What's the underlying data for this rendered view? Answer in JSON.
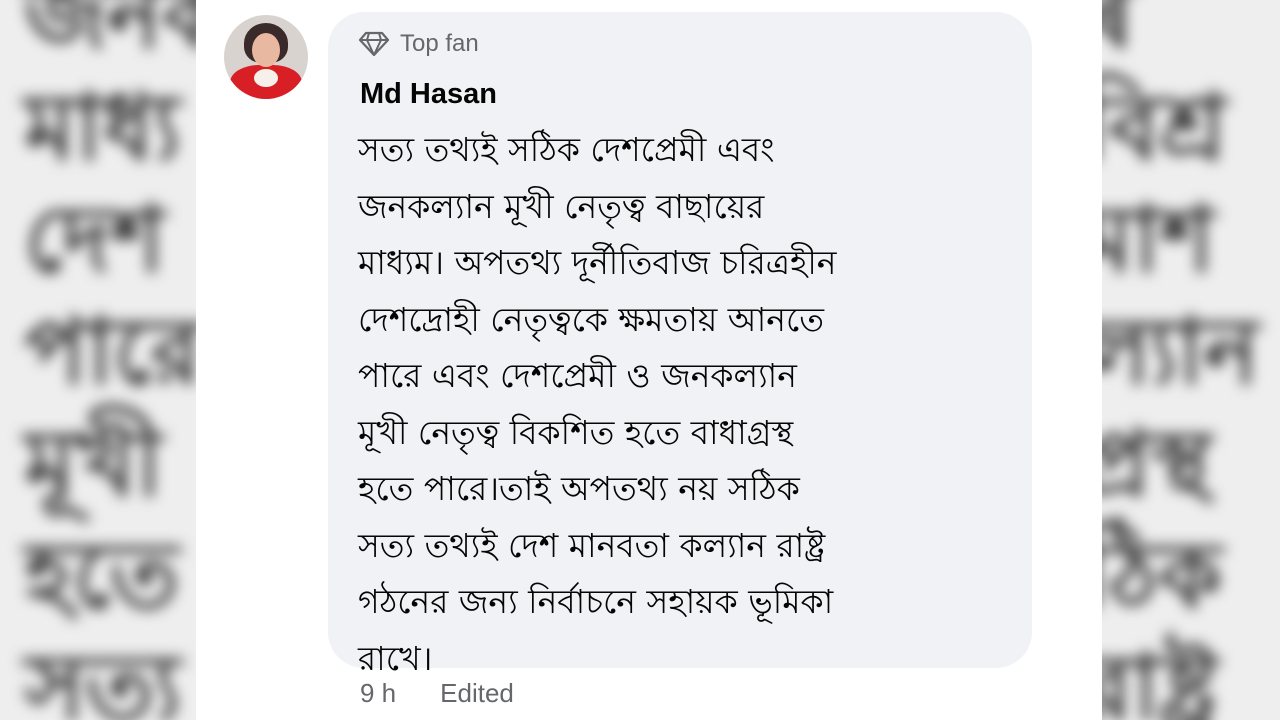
{
  "background_text": {
    "left_lines": [
      "জনক",
      "মাধ্য",
      "দেশ",
      "পারে",
      "মূখী",
      "হতে",
      "সত্য"
    ],
    "right_lines": [
      "ৰ",
      "বিশ্র",
      "মাশ",
      "ল্যান",
      "প্রস্থ",
      "ঠিক",
      "রাষ্ট্র"
    ]
  },
  "comment": {
    "badge": {
      "icon": "diamond-icon",
      "label": "Top fan"
    },
    "author": "Md Hasan",
    "body": "সত্য তথ্যই সঠিক দেশপ্রেমী এবং\nজনকল্যান মূখী নেতৃত্ব বাছায়ের\nমাধ্যম। অপতথ্য দূর্নীতিবাজ চরিত্রহীন\nদেশদ্রোহী নেতৃত্বকে ক্ষমতায় আনতে\nপারে এবং দেশপ্রেমী ও জনকল্যান\nমূখী নেতৃত্ব বিকশিত হতে বাধাগ্রস্থ\nহতে পারে।তাই অপতথ্য নয় সঠিক\nসত্য তথ্যই দেশ মানবতা কল্যান রাষ্ট্র\nগঠনের জন্য নির্বাচনে সহায়ক ভূমিকা\nরাখে।",
    "time": "9 h",
    "edited": "Edited"
  },
  "colors": {
    "bubble": "#f0f2f5",
    "text": "#050505",
    "secondary": "#65676b",
    "avatar_accent": "#d81f26"
  }
}
